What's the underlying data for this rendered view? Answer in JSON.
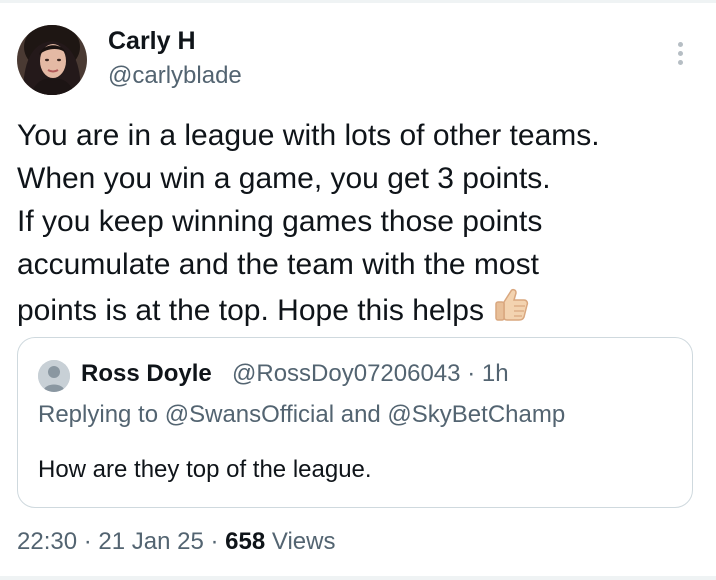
{
  "author": {
    "name": "Carly H",
    "handle": "@carlyblade",
    "avatar_icon": "user-avatar-photo"
  },
  "menu": {
    "icon": "more-vertical-icon"
  },
  "tweet": {
    "lines": [
      "You are in a league with lots of other teams.",
      "When you win a game, you get 3 points.",
      "If you keep winning games those points",
      "accumulate and the team with the most",
      "points is at the top. Hope this helps"
    ],
    "emoji": "thumbs-up-icon"
  },
  "quote": {
    "name": "Ross Doyle",
    "handle": "@RossDoy07206043",
    "separator": "·",
    "time": "1h",
    "replying_to": "Replying to @SwansOfficial and @SkyBetChamp",
    "text": "How are they top of the league."
  },
  "footer": {
    "time": "22:30",
    "dot": "·",
    "date": "21 Jan 25",
    "views_count": "658",
    "views_label": "Views"
  },
  "colors": {
    "text": "#0f1419",
    "secondary": "#536471",
    "border": "#cfd9de"
  }
}
